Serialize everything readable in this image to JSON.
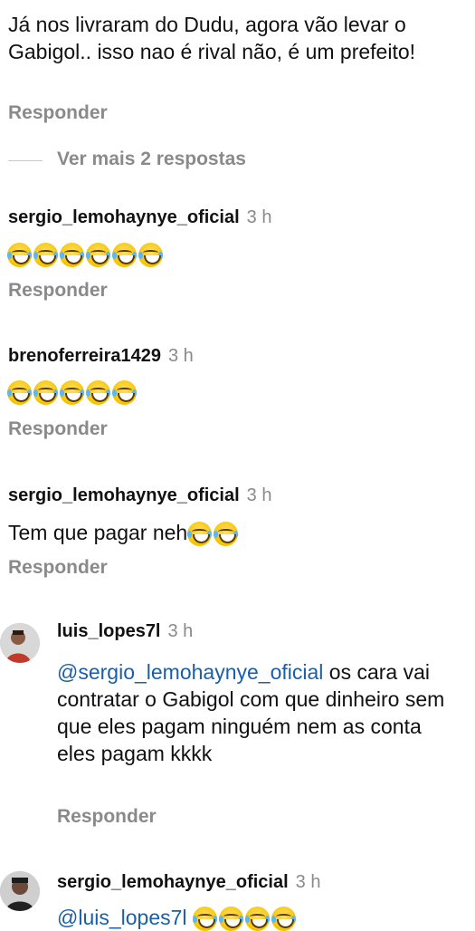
{
  "comments": {
    "c1": {
      "text": "Já nos livraram do Dudu, agora vão levar o Gabigol.. isso nao é rival não, é um prefeito!",
      "reply": "Responder"
    },
    "more": "Ver mais 2 respostas",
    "c2": {
      "user": "sergio_lemohaynye_oficial",
      "time": "3 h",
      "emoji_count": 6,
      "reply": "Responder"
    },
    "c3": {
      "user": "brenoferreira1429",
      "time": "3 h",
      "emoji_count": 5,
      "reply": "Responder"
    },
    "c4": {
      "user": "sergio_lemohaynye_oficial",
      "time": "3 h",
      "text": "Tem que pagar neh",
      "emoji_count": 2,
      "reply": "Responder"
    },
    "c5": {
      "user": "luis_lopes7l",
      "time": "3 h",
      "mention": "@sergio_lemohaynye_oficial",
      "text": " os cara vai contratar o Gabigol com que dinheiro sem que eles pagam ninguém nem as conta eles pagam kkkk",
      "reply": "Responder"
    },
    "c6": {
      "user": "sergio_lemohaynye_oficial",
      "time": "3 h",
      "mention": "@luis_lopes7l",
      "emoji_count": 4
    }
  },
  "colors": {
    "mention": "#1a5fa8",
    "muted": "#8a8a8a",
    "emoji": "#f5c400"
  },
  "icons": {
    "emoji": "face-with-tears-of-joy-icon"
  }
}
